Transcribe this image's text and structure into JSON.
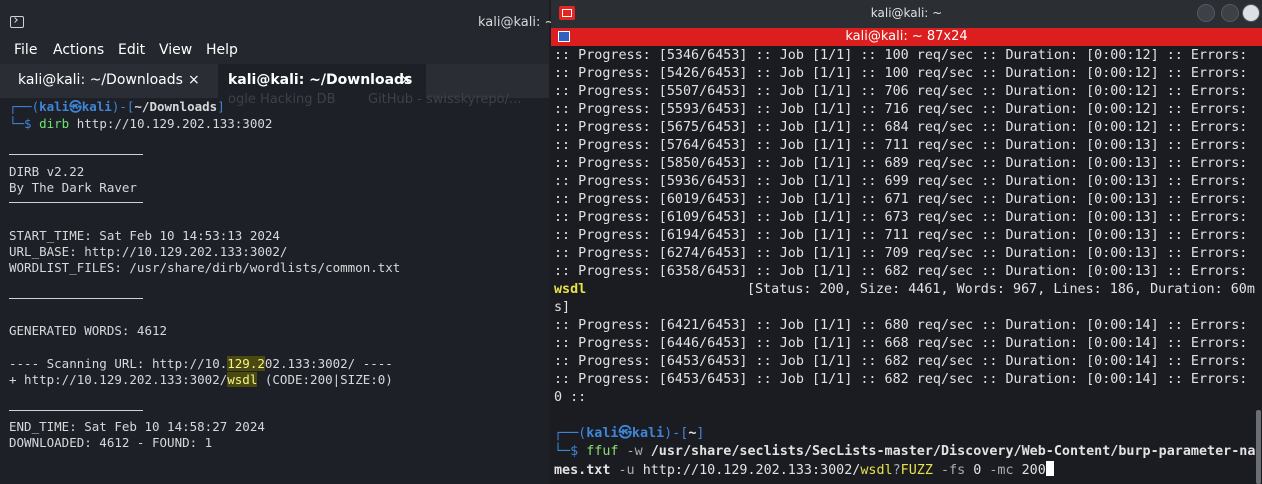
{
  "left": {
    "window_title": "kali@kali: ~/D",
    "menu": [
      "File",
      "Actions",
      "Edit",
      "View",
      "Help"
    ],
    "tabs": [
      {
        "label": "kali@kali: ~/Downloads",
        "close": "×"
      },
      {
        "label": "kali@kali: ~/Downloads",
        "close": "×"
      }
    ],
    "ghost_text": [
      "ogle Hacking DB",
      "GitHub - swisskyrepo/..."
    ],
    "prompt": {
      "open": "┌──(",
      "user": "kali㉿kali",
      "mid": ")-[",
      "path": "~/Downloads",
      "close": "]"
    },
    "command": {
      "prefix": "└─$ ",
      "cmd": "dirb",
      "args": " http://10.129.202.133:3002"
    },
    "lines": {
      "dirb_version": "DIRB v2.22",
      "author": "By The Dark Raver",
      "start_time": "START_TIME: Sat Feb 10 14:53:13 2024",
      "url_base": "URL_BASE: http://10.129.202.133:3002/",
      "wordlist": "WORDLIST_FILES: /usr/share/dirb/wordlists/common.txt",
      "generated": "GENERATED WORDS: 4612",
      "scanning_pre": "---- Scanning URL: http://10.",
      "scanning_hl": "129.2",
      "scanning_post": "02.133:3002/ ----",
      "found_pre": "+ http://10.129.202.133:3002/",
      "found_hl": "wsdl",
      "found_post": " (CODE:200|SIZE:0)",
      "end_time": "END_TIME: Sat Feb 10 14:58:27 2024",
      "downloaded": "DOWNLOADED: 4612 - FOUND: 1"
    }
  },
  "right": {
    "window_title": "kali@kali: ~",
    "tab_title": "kali@kali: ~ 87x24",
    "progress_lines": [
      ":: Progress: [5346/6453] :: Job [1/1] :: 100 req/sec :: Duration: [0:00:12] :: Errors:",
      ":: Progress: [5426/6453] :: Job [1/1] :: 100 req/sec :: Duration: [0:00:12] :: Errors:",
      ":: Progress: [5507/6453] :: Job [1/1] :: 706 req/sec :: Duration: [0:00:12] :: Errors:",
      ":: Progress: [5593/6453] :: Job [1/1] :: 716 req/sec :: Duration: [0:00:12] :: Errors:",
      ":: Progress: [5675/6453] :: Job [1/1] :: 684 req/sec :: Duration: [0:00:12] :: Errors:",
      ":: Progress: [5764/6453] :: Job [1/1] :: 711 req/sec :: Duration: [0:00:13] :: Errors:",
      ":: Progress: [5850/6453] :: Job [1/1] :: 689 req/sec :: Duration: [0:00:13] :: Errors:",
      ":: Progress: [5936/6453] :: Job [1/1] :: 699 req/sec :: Duration: [0:00:13] :: Errors:",
      ":: Progress: [6019/6453] :: Job [1/1] :: 671 req/sec :: Duration: [0:00:13] :: Errors:",
      ":: Progress: [6109/6453] :: Job [1/1] :: 673 req/sec :: Duration: [0:00:13] :: Errors:",
      ":: Progress: [6194/6453] :: Job [1/1] :: 711 req/sec :: Duration: [0:00:13] :: Errors:",
      ":: Progress: [6274/6453] :: Job [1/1] :: 709 req/sec :: Duration: [0:00:13] :: Errors:",
      ":: Progress: [6358/6453] :: Job [1/1] :: 682 req/sec :: Duration: [0:00:13] :: Errors:"
    ],
    "result_word": "wsdl",
    "result_info": "[Status: 200, Size: 4461, Words: 967, Lines: 186, Duration: 60m",
    "result_wrap": "s]",
    "progress_lines_2": [
      ":: Progress: [6421/6453] :: Job [1/1] :: 680 req/sec :: Duration: [0:00:14] :: Errors:",
      ":: Progress: [6446/6453] :: Job [1/1] :: 668 req/sec :: Duration: [0:00:14] :: Errors:",
      ":: Progress: [6453/6453] :: Job [1/1] :: 682 req/sec :: Duration: [0:00:14] :: Errors:",
      ":: Progress: [6453/6453] :: Job [1/1] :: 682 req/sec :: Duration: [0:00:14] :: Errors:"
    ],
    "errors_tail": "0 ::",
    "prompt": {
      "open": "┌──(",
      "user": "kali㉿kali",
      "mid": ")-[",
      "path": "~",
      "close": "]"
    },
    "command": {
      "prefix": "└─$ ",
      "cmd": "ffuf",
      "w_flag": " -w ",
      "wordlist": "/usr/share/seclists/SecLists-master/Discovery/Web-Content/burp-parameter-na",
      "wordlist_wrap": "mes.txt",
      "u_flag": " -u ",
      "url_pre": "http://10.129.202.133:3002/",
      "url_hl": "wsdl",
      "url_q": "?",
      "fuzz": "FUZZ",
      "fs": " -fs ",
      "fs_val": "0",
      "mc": " -mc ",
      "mc_val": "200"
    }
  },
  "colors": {
    "red_bar": "#dc1e1e",
    "prompt_blue": "#3f86d8",
    "command_green": "#8fdc6e",
    "highlight_yellow": "#e8e14a"
  }
}
